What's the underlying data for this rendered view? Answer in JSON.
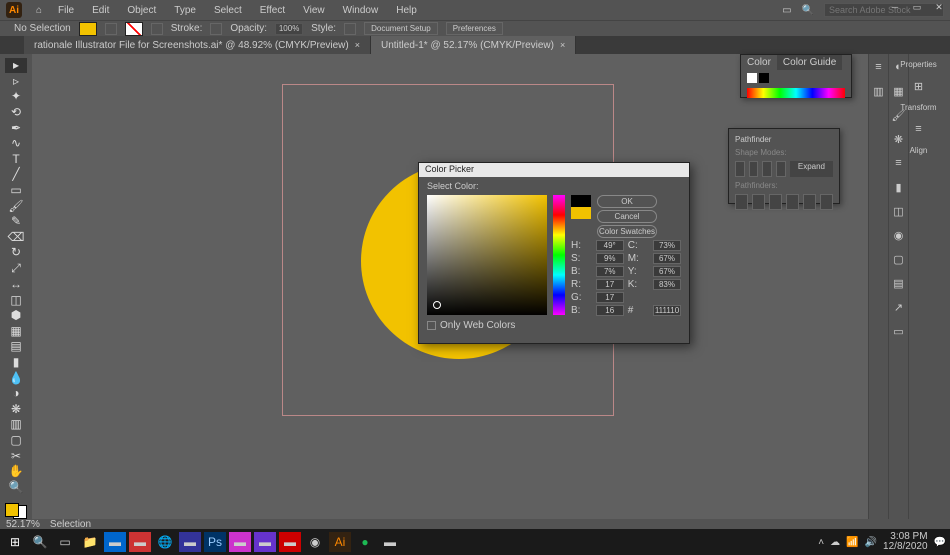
{
  "menu": {
    "items": [
      "File",
      "Edit",
      "Object",
      "Type",
      "Select",
      "Effect",
      "View",
      "Window",
      "Help"
    ]
  },
  "search": {
    "placeholder": "Search Adobe Stock"
  },
  "control": {
    "sel": "No Selection",
    "stroke": "Stroke:",
    "opacity": "Opacity:",
    "opv": "100%",
    "style": "Style:",
    "ds": "Document Setup",
    "pref": "Preferences"
  },
  "tabs": [
    {
      "label": "rationale Illustrator File for Screenshots.ai* @ 48.92% (CMYK/Preview)"
    },
    {
      "label": "Untitled-1* @ 52.17% (CMYK/Preview)"
    }
  ],
  "colorPanel": {
    "tab1": "Color",
    "tab2": "Color Guide"
  },
  "pathfinder": {
    "title": "Pathfinder",
    "shape": "Shape Modes:",
    "expand": "Expand",
    "pf": "Pathfinders:"
  },
  "picker": {
    "title": "Color Picker",
    "sub": "Select Color:",
    "ok": "OK",
    "cancel": "Cancel",
    "swb": "Color Swatches",
    "owc": "Only Web Colors",
    "h": "H:",
    "s": "S:",
    "b": "B:",
    "r": "R:",
    "g": "G:",
    "bb": "B:",
    "c": "C:",
    "m": "M:",
    "y": "Y:",
    "k": "K:",
    "hv": "49°",
    "sv": "9%",
    "bv": "7%",
    "rv": "17",
    "gv": "17",
    "bbv": "16",
    "cv": "73%",
    "mv": "67%",
    "yv": "67%",
    "kv": "83%",
    "hex": "111110"
  },
  "rside": {
    "props": "Properties",
    "transform": "Transform",
    "align": "Align"
  },
  "status": {
    "zoom": "52.17%",
    "tool": "Selection"
  },
  "taskbar": {
    "time": "3:08 PM",
    "date": "12/8/2020"
  }
}
